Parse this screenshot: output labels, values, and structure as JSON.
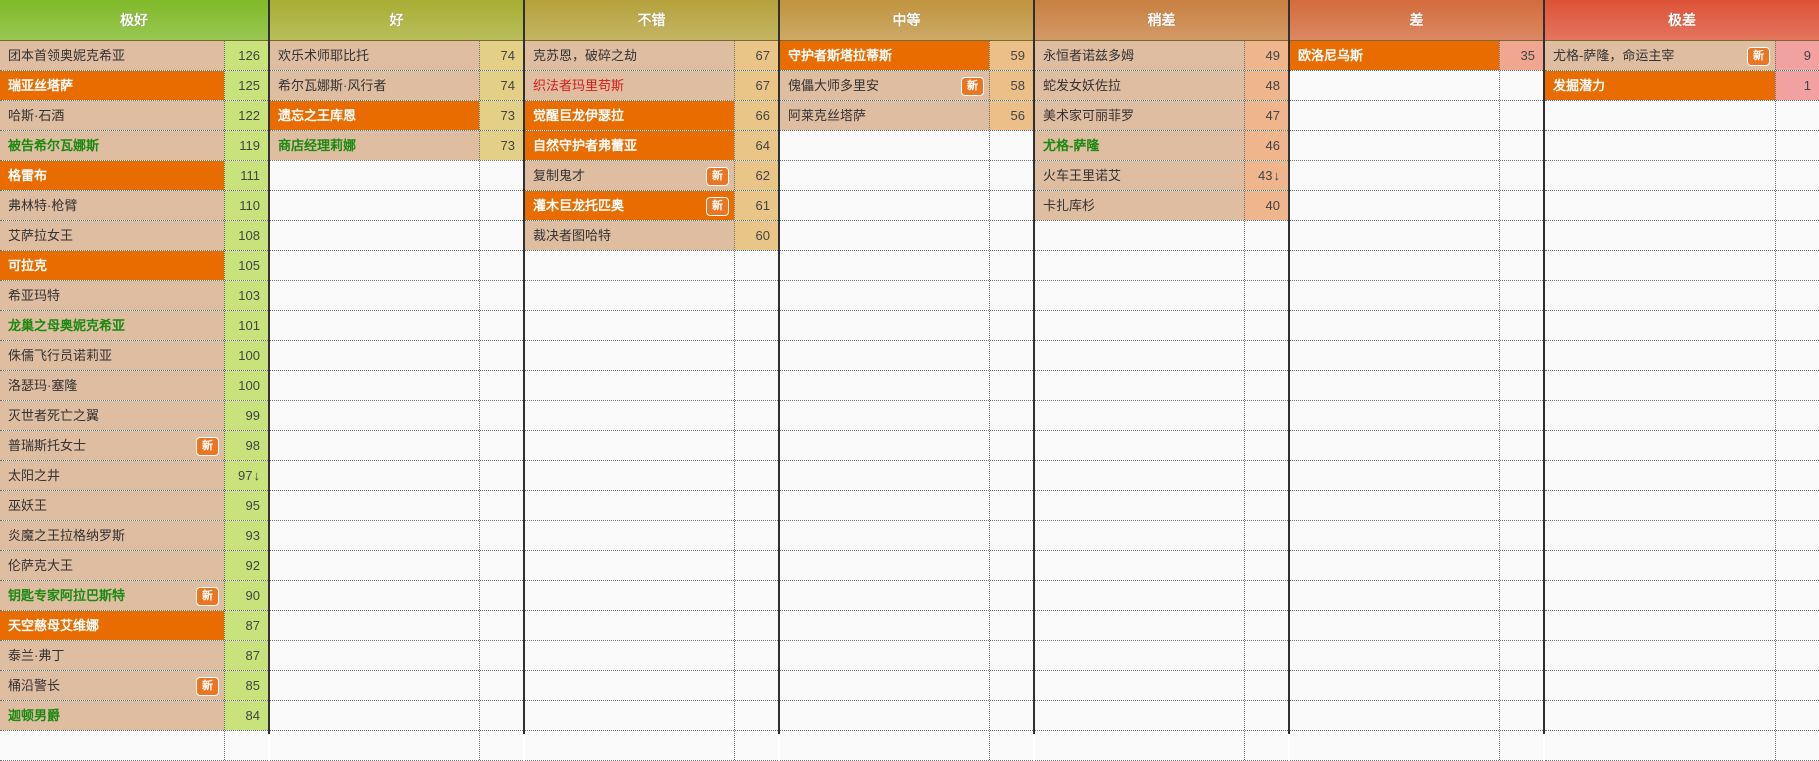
{
  "colors": {
    "orange_row": "#e86c00",
    "beige_row": "#dfbda1",
    "green_text": "#1a8a10",
    "red_text": "#d21d1d",
    "badge": "#ea7522"
  },
  "new_label": "新",
  "tiers": [
    {
      "label": "极好",
      "header_color": "#7fb928",
      "score_color": "#c8e37c",
      "items": [
        {
          "name": "团本首领奥妮克希亚",
          "score": "126",
          "style": "normal"
        },
        {
          "name": "瑞亚丝塔萨",
          "score": "125",
          "style": "orange"
        },
        {
          "name": "哈斯·石酒",
          "score": "122",
          "style": "normal"
        },
        {
          "name": "被告希尔瓦娜斯",
          "score": "119",
          "style": "green"
        },
        {
          "name": "格雷布",
          "score": "111",
          "style": "orange"
        },
        {
          "name": "弗林特·枪臂",
          "score": "110",
          "style": "normal"
        },
        {
          "name": "艾萨拉女王",
          "score": "108",
          "style": "normal"
        },
        {
          "name": "可拉克",
          "score": "105",
          "style": "orange"
        },
        {
          "name": "希亚玛特",
          "score": "103",
          "style": "normal"
        },
        {
          "name": "龙巢之母奥妮克希亚",
          "score": "101",
          "style": "green"
        },
        {
          "name": "侏儒飞行员诺莉亚",
          "score": "100",
          "style": "normal"
        },
        {
          "name": "洛瑟玛·塞隆",
          "score": "100",
          "style": "normal"
        },
        {
          "name": "灭世者死亡之翼",
          "score": "99",
          "style": "normal"
        },
        {
          "name": "普瑞斯托女士",
          "score": "98",
          "style": "normal",
          "new": true
        },
        {
          "name": "太阳之井",
          "score": "97",
          "style": "normal",
          "arrow": "↓"
        },
        {
          "name": "巫妖王",
          "score": "95",
          "style": "normal"
        },
        {
          "name": "炎魔之王拉格纳罗斯",
          "score": "93",
          "style": "normal"
        },
        {
          "name": "伦萨克大王",
          "score": "92",
          "style": "normal"
        },
        {
          "name": "钥匙专家阿拉巴斯特",
          "score": "90",
          "style": "green",
          "new": true
        },
        {
          "name": "天空慈母艾维娜",
          "score": "87",
          "style": "orange"
        },
        {
          "name": "泰兰·弗丁",
          "score": "87",
          "style": "normal"
        },
        {
          "name": "桶沿警长",
          "score": "85",
          "style": "normal",
          "new": true
        },
        {
          "name": "迦顿男爵",
          "score": "84",
          "style": "green"
        }
      ]
    },
    {
      "label": "好",
      "header_color": "#a8ad33",
      "score_color": "#e3cf85",
      "items": [
        {
          "name": "欢乐术师耶比托",
          "score": "74",
          "style": "normal"
        },
        {
          "name": "希尔瓦娜斯·风行者",
          "score": "74",
          "style": "normal"
        },
        {
          "name": "遗忘之王库恩",
          "score": "73",
          "style": "orange"
        },
        {
          "name": "商店经理莉娜",
          "score": "73",
          "style": "green"
        }
      ]
    },
    {
      "label": "不错",
      "header_color": "#b5a23c",
      "score_color": "#e9c688",
      "items": [
        {
          "name": "克苏恩，破碎之劫",
          "score": "67",
          "style": "normal"
        },
        {
          "name": "织法者玛里苟斯",
          "score": "67",
          "style": "red"
        },
        {
          "name": "觉醒巨龙伊瑟拉",
          "score": "66",
          "style": "orange"
        },
        {
          "name": "自然守护者弗蕾亚",
          "score": "64",
          "style": "orange"
        },
        {
          "name": "复制鬼才",
          "score": "62",
          "style": "normal",
          "new": true
        },
        {
          "name": "灌木巨龙托匹奥",
          "score": "61",
          "style": "orange",
          "new": true
        },
        {
          "name": "裁决者图哈特",
          "score": "60",
          "style": "normal"
        }
      ]
    },
    {
      "label": "中等",
      "header_color": "#c0943f",
      "score_color": "#ecbf88",
      "items": [
        {
          "name": "守护者斯塔拉蒂斯",
          "score": "59",
          "style": "orange"
        },
        {
          "name": "傀儡大师多里安",
          "score": "58",
          "style": "normal",
          "new": true
        },
        {
          "name": "阿莱克丝塔萨",
          "score": "56",
          "style": "normal"
        }
      ]
    },
    {
      "label": "稍差",
      "header_color": "#c88040",
      "score_color": "#efb58c",
      "items": [
        {
          "name": "永恒者诺兹多姆",
          "score": "49",
          "style": "normal"
        },
        {
          "name": "蛇发女妖佐拉",
          "score": "48",
          "style": "normal"
        },
        {
          "name": "美术家可丽菲罗",
          "score": "47",
          "style": "normal"
        },
        {
          "name": "尤格-萨隆",
          "score": "46",
          "style": "green"
        },
        {
          "name": "火车王里诺艾",
          "score": "43",
          "style": "normal",
          "arrow": "↓"
        },
        {
          "name": "卡扎库杉",
          "score": "40",
          "style": "normal"
        }
      ]
    },
    {
      "label": "差",
      "header_color": "#d36b3c",
      "score_color": "#f0a690",
      "items": [
        {
          "name": "欧洛尼乌斯",
          "score": "35",
          "style": "orange"
        }
      ]
    },
    {
      "label": "极差",
      "header_color": "#dd5236",
      "score_color": "#f1a2a0",
      "items": [
        {
          "name": "尤格-萨隆，命运主宰",
          "score": "9",
          "style": "normal",
          "new": true
        },
        {
          "name": "发掘潜力",
          "score": "1",
          "style": "orange"
        }
      ]
    }
  ]
}
